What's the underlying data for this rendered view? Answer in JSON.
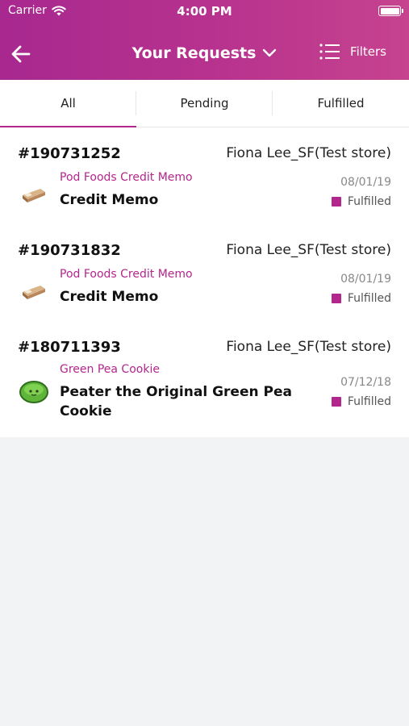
{
  "status_bar": {
    "carrier": "Carrier",
    "time": "4:00 PM"
  },
  "header": {
    "title": "Your Requests",
    "filters_label": "Filters",
    "gradient_start": "#a7288f",
    "gradient_end": "#c6438f"
  },
  "tabs": [
    {
      "label": "All",
      "active": true
    },
    {
      "label": "Pending",
      "active": false
    },
    {
      "label": "Fulfilled",
      "active": false
    }
  ],
  "accent_color": "#b3268c",
  "requests": [
    {
      "order_no": "#190731252",
      "store": "Fiona Lee_SF(Test store)",
      "category": "Pod Foods Credit Memo",
      "product": "Credit Memo",
      "date": "08/01/19",
      "status": "Fulfilled",
      "thumb_icon": "snack-bar-icon"
    },
    {
      "order_no": "#190731832",
      "store": "Fiona Lee_SF(Test store)",
      "category": "Pod Foods Credit Memo",
      "product": "Credit Memo",
      "date": "08/01/19",
      "status": "Fulfilled",
      "thumb_icon": "snack-bar-icon"
    },
    {
      "order_no": "#180711393",
      "store": "Fiona Lee_SF(Test store)",
      "category": "Green Pea Cookie",
      "product": "Peater the Original Green Pea Cookie",
      "date": "07/12/18",
      "status": "Fulfilled",
      "thumb_icon": "green-pea-cookie-icon"
    }
  ]
}
